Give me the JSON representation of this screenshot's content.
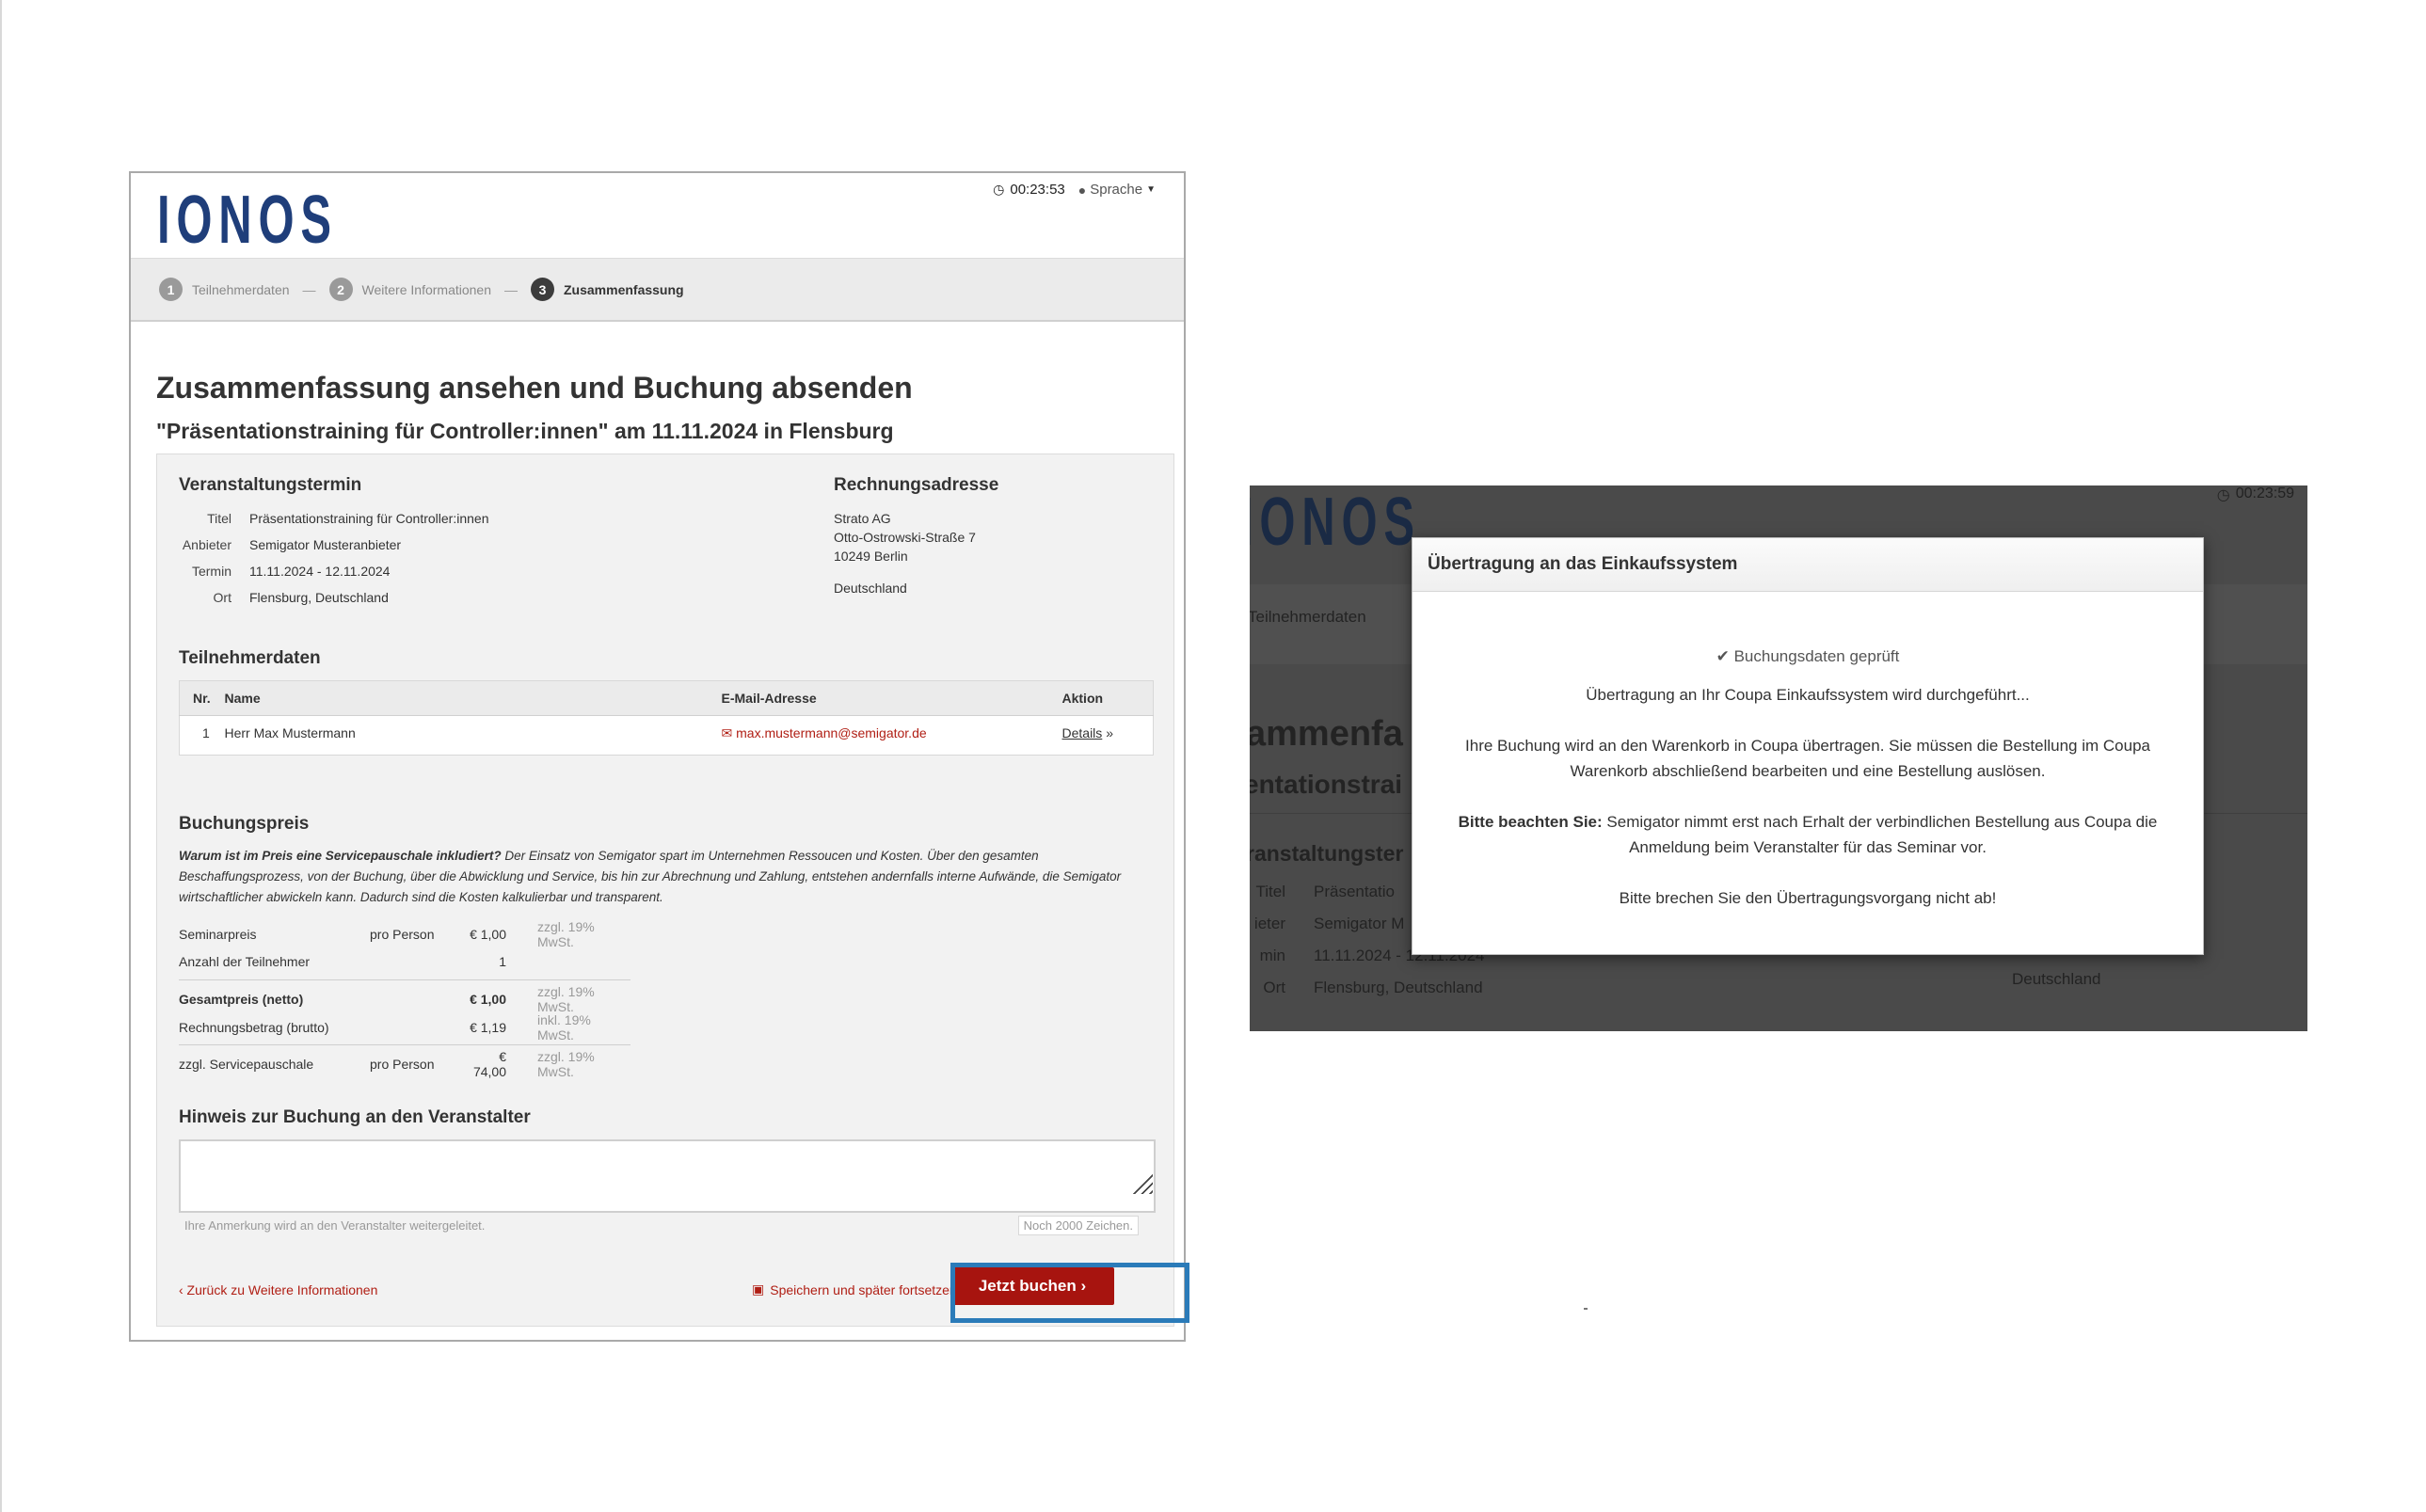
{
  "booking": {
    "logo": "IONOS",
    "timer": "00:23:53",
    "language_label": "Sprache",
    "steps": [
      {
        "num": "1",
        "label": "Teilnehmerdaten"
      },
      {
        "num": "2",
        "label": "Weitere Informationen"
      },
      {
        "num": "3",
        "label": "Zusammenfassung"
      }
    ],
    "step_separator": "—",
    "title": "Zusammenfassung ansehen und Buchung absenden",
    "subtitle": "\"Präsentationstraining für Controller:innen\" am 11.11.2024 in Flensburg",
    "event": {
      "heading": "Veranstaltungstermin",
      "rows": [
        {
          "k": "Titel",
          "v": "Präsentationstraining für Controller:innen"
        },
        {
          "k": "Anbieter",
          "v": "Semigator Musteranbieter"
        },
        {
          "k": "Termin",
          "v": "11.11.2024 - 12.11.2024"
        },
        {
          "k": "Ort",
          "v": "Flensburg, Deutschland"
        }
      ]
    },
    "billing": {
      "heading": "Rechnungsadresse",
      "line1": "Strato AG",
      "line2": "Otto-Ostrowski-Straße 7",
      "line3": "10249 Berlin",
      "country": "Deutschland"
    },
    "participants": {
      "heading": "Teilnehmerdaten",
      "columns": [
        "Nr.",
        "Name",
        "E-Mail-Adresse",
        "Aktion"
      ],
      "rows": [
        {
          "nr": "1",
          "name": "Herr Max Mustermann",
          "email": "max.mustermann@semigator.de",
          "action": "Details"
        }
      ]
    },
    "price": {
      "heading": "Buchungspreis",
      "note_bold": "Warum ist im Preis eine Servicepauschale inkludiert?",
      "note_text": " Der Einsatz von Semigator spart im Unternehmen Ressoucen und Kosten. Über den gesamten Beschaffungsprozess, von der Buchung, über die Abwicklung und Service, bis hin zur Abrechnung und Zahlung, entstehen andernfalls interne Aufwände, die Semigator wirtschaftlicher abwickeln kann. Dadurch sind die Kosten kalkulierbar und transparent.",
      "rows": [
        {
          "label": "Seminarpreis",
          "per": "pro Person",
          "value": "€ 1,00",
          "tax": "zzgl. 19% MwSt."
        },
        {
          "label": "Anzahl der Teilnehmer",
          "per": "",
          "value": "1",
          "tax": ""
        },
        {
          "label": "Gesamtpreis (netto)",
          "per": "",
          "value": "€ 1,00",
          "tax": "zzgl. 19% MwSt."
        },
        {
          "label": "Rechnungsbetrag (brutto)",
          "per": "",
          "value": "€ 1,19",
          "tax": "inkl. 19% MwSt."
        },
        {
          "label": "zzgl. Servicepauschale",
          "per": "pro Person",
          "value": "€ 74,00",
          "tax": "zzgl. 19% MwSt."
        }
      ]
    },
    "note_section": {
      "heading": "Hinweis zur Buchung an den Veranstalter",
      "value": "",
      "hint": "Ihre Anmerkung wird an den Veranstalter weitergeleitet.",
      "counter": "Noch 2000 Zeichen."
    },
    "back_link": "‹ Zurück zu Weitere Informationen",
    "save_link": "Speichern und später fortsetzen",
    "book_button": "Jetzt buchen ›"
  },
  "overlay": {
    "timer": "00:23:59",
    "bg_logo": "IONOS",
    "bg_step": "Teilnehmerdaten",
    "bg_title": "ammenfa",
    "bg_subtitle": "entationstrai",
    "bg_section": "ranstaltungster",
    "bg_rows": [
      {
        "k": "Titel",
        "v": "Präsentatio"
      },
      {
        "k": "ieter",
        "v": "Semigator M"
      },
      {
        "k": "min",
        "v": "11.11.2024 - 12.11.2024"
      },
      {
        "k": "Ort",
        "v": "Flensburg, Deutschland"
      }
    ],
    "bg_country": "Deutschland",
    "modal_title": "Übertragung an das Einkaufssystem",
    "check_text": "Buchungsdaten geprüft",
    "line1": "Übertragung an Ihr Coupa Einkaufssystem wird durchgeführt...",
    "line2a": "Ihre Buchung wird an den Warenkorb in Coupa übertragen. Sie müssen die Bestellung im Coupa",
    "line2b": "Warenkorb abschließend bearbeiten und eine Bestellung auslösen.",
    "note_bold": "Bitte beachten Sie:",
    "line3a": " Semigator nimmt erst nach Erhalt der verbindlichen Bestellung aus Coupa die",
    "line3b": "Anmeldung beim Veranstalter für das Seminar vor.",
    "line4": "Bitte brechen Sie den Übertragungsvorgang nicht ab!"
  },
  "colors": {
    "accent": "#a7140f",
    "brand": "#1f3e7a",
    "highlight": "#2b7bb9",
    "link": "#b01e14"
  }
}
